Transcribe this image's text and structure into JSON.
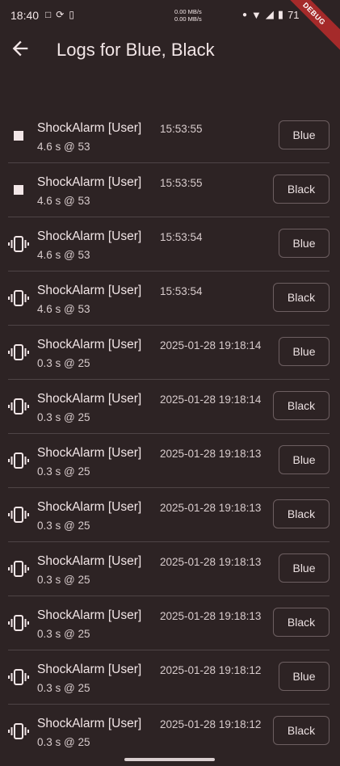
{
  "status_bar": {
    "time": "18:40",
    "net_up": "0.00 MB/s",
    "net_down": "0.00 MB/s",
    "battery": "71",
    "debug_label": "DEBUG"
  },
  "app_bar": {
    "title": "Logs for Blue, Black"
  },
  "logs": [
    {
      "icon": "stop-icon",
      "name": "ShockAlarm [User]",
      "time": "15:53:55",
      "detail": "4.6 s @ 53",
      "button": "Blue"
    },
    {
      "icon": "stop-icon",
      "name": "ShockAlarm [User]",
      "time": "15:53:55",
      "detail": "4.6 s @ 53",
      "button": "Black"
    },
    {
      "icon": "vibrate-icon",
      "name": "ShockAlarm [User]",
      "time": "15:53:54",
      "detail": "4.6 s @ 53",
      "button": "Blue"
    },
    {
      "icon": "vibrate-icon",
      "name": "ShockAlarm [User]",
      "time": "15:53:54",
      "detail": "4.6 s @ 53",
      "button": "Black"
    },
    {
      "icon": "vibrate-icon",
      "name": "ShockAlarm [User]",
      "time": "2025-01-28 19:18:14",
      "detail": "0.3 s @ 25",
      "button": "Blue"
    },
    {
      "icon": "vibrate-icon",
      "name": "ShockAlarm [User]",
      "time": "2025-01-28 19:18:14",
      "detail": "0.3 s @ 25",
      "button": "Black"
    },
    {
      "icon": "vibrate-icon",
      "name": "ShockAlarm [User]",
      "time": "2025-01-28 19:18:13",
      "detail": "0.3 s @ 25",
      "button": "Blue"
    },
    {
      "icon": "vibrate-icon",
      "name": "ShockAlarm [User]",
      "time": "2025-01-28 19:18:13",
      "detail": "0.3 s @ 25",
      "button": "Black"
    },
    {
      "icon": "vibrate-icon",
      "name": "ShockAlarm [User]",
      "time": "2025-01-28 19:18:13",
      "detail": "0.3 s @ 25",
      "button": "Blue"
    },
    {
      "icon": "vibrate-icon",
      "name": "ShockAlarm [User]",
      "time": "2025-01-28 19:18:13",
      "detail": "0.3 s @ 25",
      "button": "Black"
    },
    {
      "icon": "vibrate-icon",
      "name": "ShockAlarm [User]",
      "time": "2025-01-28 19:18:12",
      "detail": "0.3 s @ 25",
      "button": "Blue"
    },
    {
      "icon": "vibrate-icon",
      "name": "ShockAlarm [User]",
      "time": "2025-01-28 19:18:12",
      "detail": "0.3 s @ 25",
      "button": "Black"
    }
  ]
}
